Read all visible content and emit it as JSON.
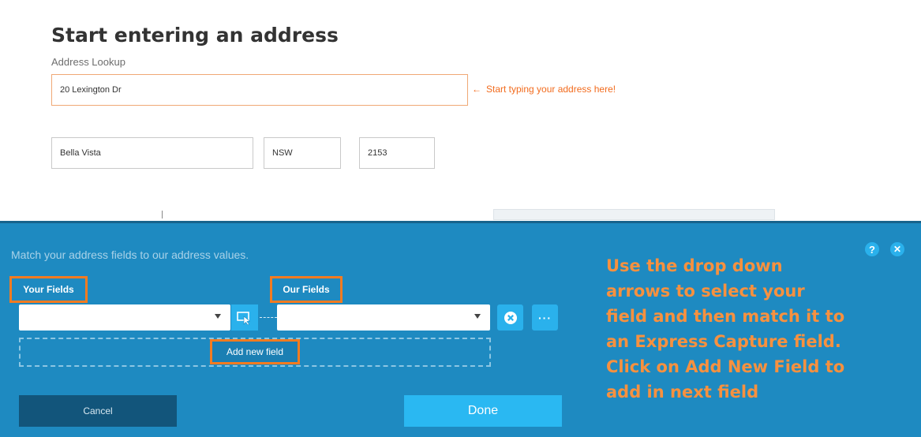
{
  "form": {
    "title": "Start entering an address",
    "lookup_label": "Address Lookup",
    "lookup_value": "20 Lexington Dr",
    "hint": "Start typing your address here!",
    "hint_arrow": "←",
    "suburb_value": "Bella Vista",
    "state_value": "NSW",
    "postcode_value": "2153"
  },
  "panel": {
    "subtitle": "Match your address fields to our address values.",
    "your_fields_label": "Your Fields",
    "our_fields_label": "Our Fields",
    "your_field_value": "",
    "our_field_value": "",
    "more_label": "···",
    "add_new_field_label": "Add new field",
    "cancel_label": "Cancel",
    "done_label": "Done",
    "help_symbol": "?",
    "close_symbol": "✕",
    "remove_symbol": "✕",
    "icons": [
      "help-icon",
      "close-icon",
      "field-picker-icon",
      "remove-icon",
      "more-icon",
      "chevron-down-icon"
    ],
    "instructions": [
      "Use the drop down",
      "arrows to select your",
      "field and then match it to",
      "an Express Capture field.",
      "Click on Add New Field to",
      "add in next field"
    ]
  },
  "colors": {
    "panel_bg": "#1e8ac1",
    "accent_orange": "#f47b20",
    "button_blue": "#2ab1ec",
    "cancel_bg": "#12557b"
  }
}
